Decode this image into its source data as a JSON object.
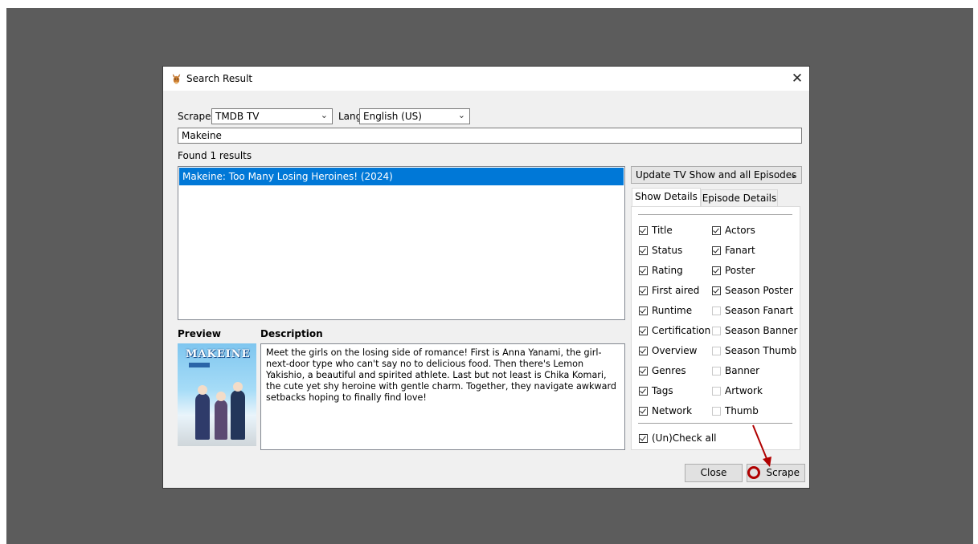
{
  "window": {
    "title": "Search Result",
    "close_glyph": "✕"
  },
  "toolbar": {
    "scraper_label": "Scraper",
    "scraper_value": "TMDB TV",
    "language_label": "Language",
    "language_value": "English (US)"
  },
  "search": {
    "query": "Makeine"
  },
  "results": {
    "summary": "Found 1 results",
    "items": [
      {
        "label": "Makeine: Too Many Losing Heroines! (2024)",
        "selected": true
      }
    ]
  },
  "preview": {
    "preview_header": "Preview",
    "description_header": "Description",
    "poster_logo_text": "MAKEINE",
    "description": "Meet the girls on the losing side of romance! First is Anna Yanami, the girl-next-door type who can't say no to delicious food. Then there's Lemon Yakishio, a beautiful and spirited athlete. Last but not least is Chika Komari, the cute yet shy heroine with gentle charm. Together, they navigate awkward setbacks hoping to finally find love!"
  },
  "options": {
    "update_mode": "Update TV Show and all Episodes",
    "tabs": [
      {
        "label": "Show Details",
        "active": true
      },
      {
        "label": "Episode Details",
        "active": false
      }
    ],
    "left_checks": [
      {
        "label": "Title",
        "checked": true
      },
      {
        "label": "Status",
        "checked": true
      },
      {
        "label": "Rating",
        "checked": true
      },
      {
        "label": "First aired",
        "checked": true
      },
      {
        "label": "Runtime",
        "checked": true
      },
      {
        "label": "Certification",
        "checked": true
      },
      {
        "label": "Overview",
        "checked": true
      },
      {
        "label": "Genres",
        "checked": true
      },
      {
        "label": "Tags",
        "checked": true
      },
      {
        "label": "Network",
        "checked": true
      }
    ],
    "right_checks": [
      {
        "label": "Actors",
        "checked": true
      },
      {
        "label": "Fanart",
        "checked": true
      },
      {
        "label": "Poster",
        "checked": true
      },
      {
        "label": "Season Poster",
        "checked": true
      },
      {
        "label": "Season Fanart",
        "checked": false
      },
      {
        "label": "Season Banner",
        "checked": false
      },
      {
        "label": "Season Thumb",
        "checked": false
      },
      {
        "label": "Banner",
        "checked": false
      },
      {
        "label": "Artwork",
        "checked": false
      },
      {
        "label": "Thumb",
        "checked": false
      }
    ],
    "check_all": {
      "label": "(Un)Check all",
      "checked": true
    }
  },
  "buttons": {
    "close": "Close",
    "scrape": "Scrape"
  },
  "colors": {
    "selection": "#0078d7",
    "annotation": "#b00000",
    "backdrop": "#5c5c5c"
  }
}
